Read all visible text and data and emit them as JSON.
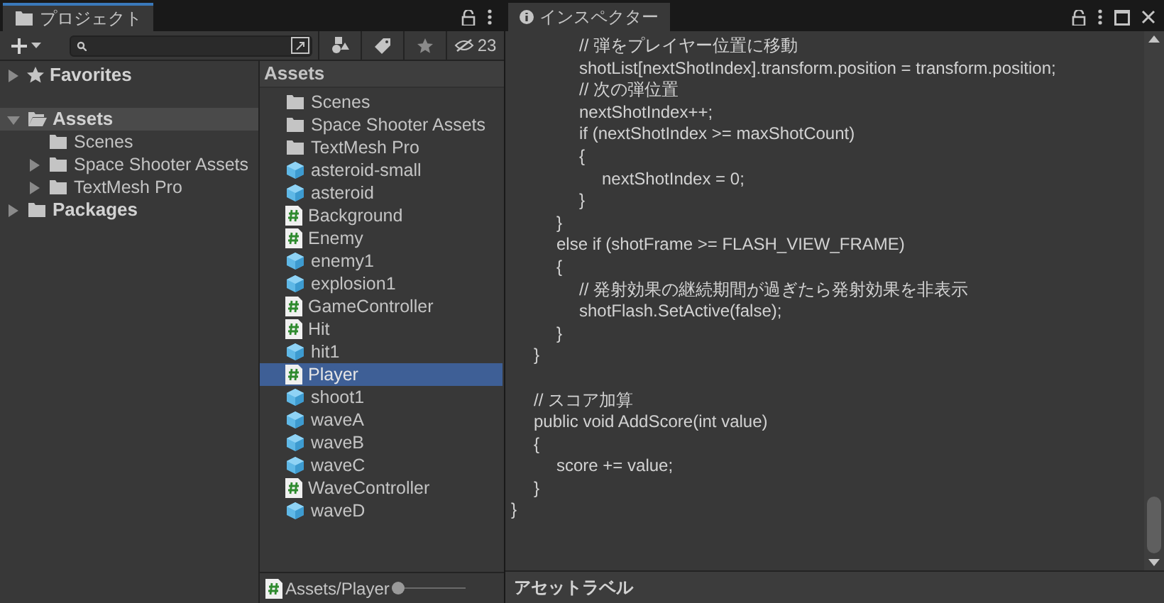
{
  "project": {
    "tab": "プロジェクト",
    "hidden_count": "23",
    "tree": [
      {
        "label": "Favorites",
        "kind": "favorites",
        "expanded": false,
        "selected": false
      },
      {
        "label": "Assets",
        "kind": "folder",
        "expanded": true,
        "selected": true,
        "children": [
          {
            "label": "Scenes",
            "kind": "folder",
            "selected": false
          },
          {
            "label": "Space Shooter Assets",
            "kind": "folder",
            "expanded": false,
            "selected": false
          },
          {
            "label": "TextMesh Pro",
            "kind": "folder",
            "expanded": false,
            "selected": false
          }
        ]
      },
      {
        "label": "Packages",
        "kind": "folder",
        "expanded": false,
        "selected": false
      }
    ],
    "list_title": "Assets",
    "items": [
      {
        "name": "Scenes",
        "kind": "folder",
        "selected": false
      },
      {
        "name": "Space Shooter Assets",
        "kind": "folder",
        "selected": false
      },
      {
        "name": "TextMesh Pro",
        "kind": "folder",
        "selected": false
      },
      {
        "name": "asteroid-small",
        "kind": "prefab",
        "selected": false
      },
      {
        "name": "asteroid",
        "kind": "prefab",
        "selected": false
      },
      {
        "name": "Background",
        "kind": "script",
        "selected": false
      },
      {
        "name": "Enemy",
        "kind": "script",
        "selected": false
      },
      {
        "name": "enemy1",
        "kind": "prefab",
        "selected": false
      },
      {
        "name": "explosion1",
        "kind": "prefab",
        "selected": false
      },
      {
        "name": "GameController",
        "kind": "script",
        "selected": false
      },
      {
        "name": "Hit",
        "kind": "script",
        "selected": false
      },
      {
        "name": "hit1",
        "kind": "prefab",
        "selected": false
      },
      {
        "name": "Player",
        "kind": "script",
        "selected": true
      },
      {
        "name": "shoot1",
        "kind": "prefab",
        "selected": false
      },
      {
        "name": "waveA",
        "kind": "prefab",
        "selected": false
      },
      {
        "name": "waveB",
        "kind": "prefab",
        "selected": false
      },
      {
        "name": "waveC",
        "kind": "prefab",
        "selected": false
      },
      {
        "name": "WaveController",
        "kind": "script",
        "selected": false
      },
      {
        "name": "waveD",
        "kind": "prefab",
        "selected": false
      }
    ],
    "path": "Assets/Player",
    "zoom": {
      "level": 0
    }
  },
  "inspector": {
    "tab": "インスペクター",
    "label_bar": "アセットラベル",
    "code": [
      {
        "text": "\t\t\t// 弾をプレイヤー位置に移動"
      },
      {
        "text": "\t\t\tshotList[nextShotIndex].transform.position = transform.position;"
      },
      {
        "text": "\t\t\t// 次の弾位置"
      },
      {
        "text": "\t\t\tnextShotIndex++;"
      },
      {
        "text": "\t\t\tif (nextShotIndex >= maxShotCount)"
      },
      {
        "text": "\t\t\t{"
      },
      {
        "text": "\t\t\t\tnextShotIndex = 0;"
      },
      {
        "text": "\t\t\t}"
      },
      {
        "text": "\t\t}"
      },
      {
        "text": "\t\telse if (shotFrame >= FLASH_VIEW_FRAME)"
      },
      {
        "text": "\t\t{"
      },
      {
        "text": "\t\t\t// 発射効果の継続期間が過ぎたら発射効果を非表示"
      },
      {
        "text": "\t\t\tshotFlash.SetActive(false);"
      },
      {
        "text": "\t\t}"
      },
      {
        "text": "\t}"
      },
      {
        "text": "\t// スコア加算",
        "gap_before": true
      },
      {
        "text": "\tpublic void AddScore(int value)"
      },
      {
        "text": "\t{"
      },
      {
        "text": "\t\tscore += value;"
      },
      {
        "text": "\t}"
      },
      {
        "text": "}"
      }
    ]
  }
}
